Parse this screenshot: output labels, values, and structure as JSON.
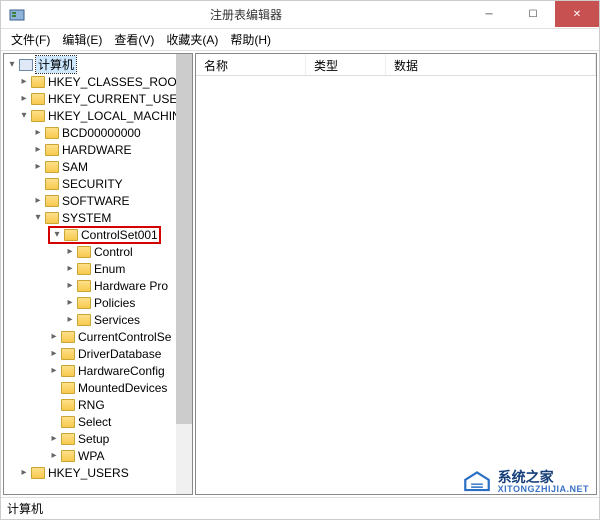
{
  "window": {
    "title": "注册表编辑器"
  },
  "menu": {
    "file": "文件(F)",
    "edit": "编辑(E)",
    "view": "查看(V)",
    "favorites": "收藏夹(A)",
    "help": "帮助(H)"
  },
  "list": {
    "col_name": "名称",
    "col_type": "类型",
    "col_data": "数据"
  },
  "tree": {
    "root": "计算机",
    "hive0": "HKEY_CLASSES_ROOT",
    "hive1": "HKEY_CURRENT_USER",
    "hive2": "HKEY_LOCAL_MACHINE",
    "hlm": {
      "b0": "BCD00000000",
      "b1": "HARDWARE",
      "b2": "SAM",
      "b3": "SECURITY",
      "b4": "SOFTWARE",
      "b5": "SYSTEM"
    },
    "system": {
      "cs001": "ControlSet001",
      "cs001_children": {
        "c0": "Control",
        "c1": "Enum",
        "c2": "Hardware Pro",
        "c3": "Policies",
        "c4": "Services"
      },
      "s1": "CurrentControlSe",
      "s2": "DriverDatabase",
      "s3": "HardwareConfig",
      "s4": "MountedDevices",
      "s5": "RNG",
      "s6": "Select",
      "s7": "Setup",
      "s8": "WPA"
    },
    "hive3": "HKEY_USERS"
  },
  "statusbar": {
    "path": "计算机"
  },
  "watermark": {
    "brand": "系统之家",
    "url": "XITONGZHIJIA.NET"
  }
}
